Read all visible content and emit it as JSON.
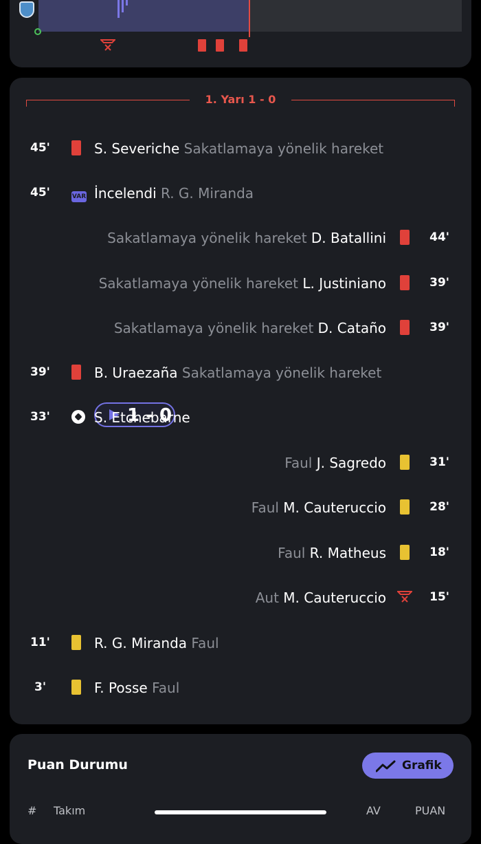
{
  "period": {
    "title": "1. Yarı 1 - 0"
  },
  "var_label": "VAR",
  "events": [
    {
      "side": "home",
      "minute": "45'",
      "type": "red",
      "player": "S. Severiche",
      "desc": "Sakatlamaya yönelik hareket"
    },
    {
      "side": "home",
      "minute": "45'",
      "type": "var",
      "player": "İncelendi",
      "desc": "R. G. Miranda"
    },
    {
      "side": "away",
      "minute": "44'",
      "type": "red",
      "player": "D. Batallini",
      "desc": "Sakatlamaya yönelik hareket"
    },
    {
      "side": "away",
      "minute": "39'",
      "type": "red",
      "player": "L. Justiniano",
      "desc": "Sakatlamaya yönelik hareket"
    },
    {
      "side": "away",
      "minute": "39'",
      "type": "red",
      "player": "D. Cataño",
      "desc": "Sakatlamaya yönelik hareket"
    },
    {
      "side": "home",
      "minute": "39'",
      "type": "red",
      "player": "B. Uraezaña",
      "desc": "Sakatlamaya yönelik hareket"
    },
    {
      "side": "home",
      "minute": "33'",
      "type": "goal",
      "score": "1 - 0",
      "player": "S. Etchebarne"
    },
    {
      "side": "away",
      "minute": "31'",
      "type": "yellow",
      "player": "J. Sagredo",
      "desc": "Faul"
    },
    {
      "side": "away",
      "minute": "28'",
      "type": "yellow",
      "player": "M. Cauteruccio",
      "desc": "Faul"
    },
    {
      "side": "away",
      "minute": "18'",
      "type": "yellow",
      "player": "R. Matheus",
      "desc": "Faul"
    },
    {
      "side": "away",
      "minute": "15'",
      "type": "offside",
      "player": "M. Cauteruccio",
      "desc": "Aut"
    },
    {
      "side": "home",
      "minute": "11'",
      "type": "yellow",
      "player": "R. G. Miranda",
      "desc": "Faul"
    },
    {
      "side": "home",
      "minute": "3'",
      "type": "yellow",
      "player": "F. Posse",
      "desc": "Faul"
    }
  ],
  "standings": {
    "title": "Puan Durumu",
    "chart_button": "Grafik",
    "columns": {
      "rank": "#",
      "team": "Takım",
      "goal_diff": "AV",
      "points": "PUAN"
    }
  },
  "colors": {
    "red_card": "#e0413a",
    "yellow_card": "#e8c232",
    "accent": "#7472e4",
    "period": "#e8574d"
  }
}
